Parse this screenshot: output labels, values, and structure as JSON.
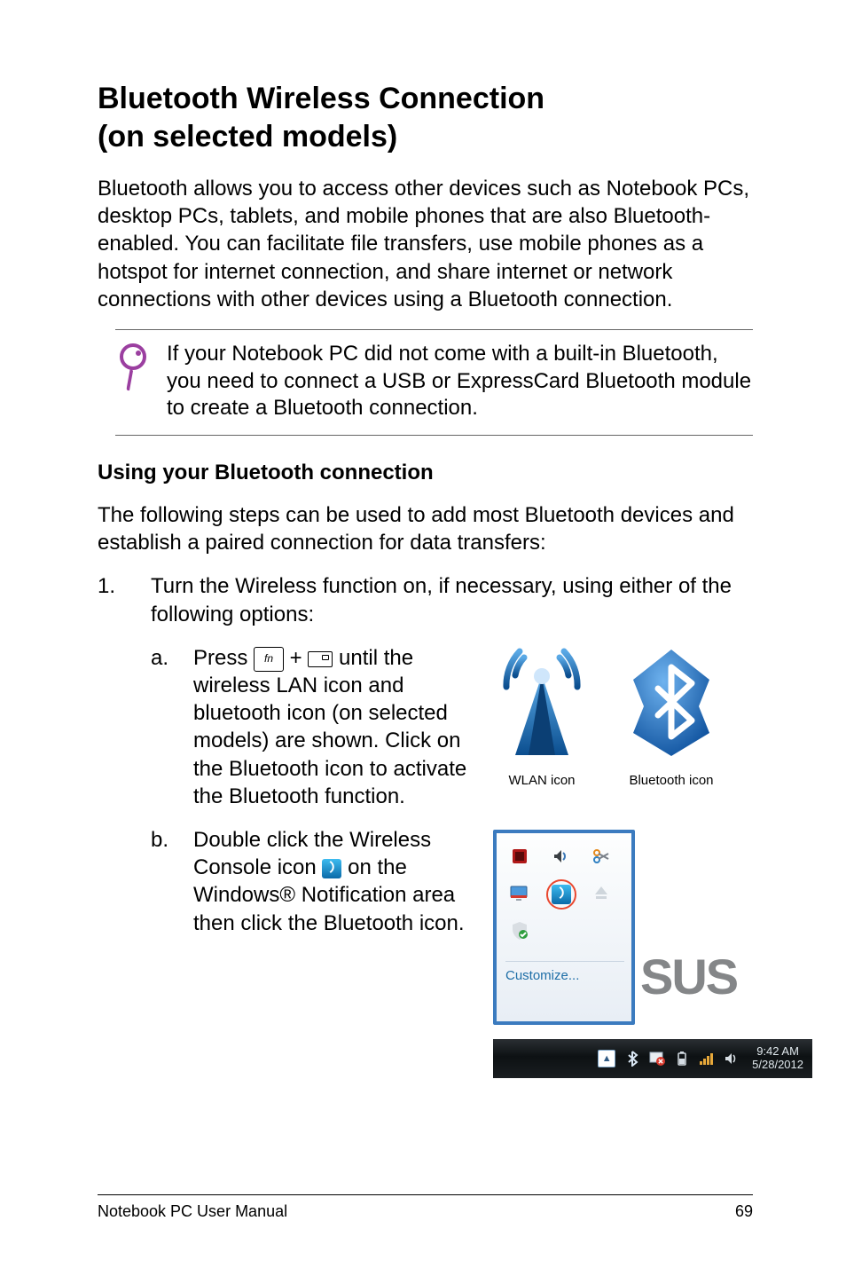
{
  "title_line1": "Bluetooth Wireless Connection",
  "title_line2": "(on selected models)",
  "intro": "Bluetooth allows you to access other devices such as Notebook PCs, desktop PCs, tablets, and mobile phones that are also Bluetooth-enabled. You can facilitate file transfers, use mobile phones as a hotspot for internet connection, and share internet or network connections with other devices using a Bluetooth connection.",
  "note": "If your Notebook PC did not come with a built-in Bluetooth, you need to connect a USB or ExpressCard Bluetooth module to create a Bluetooth connection.",
  "subheading": "Using your Bluetooth connection",
  "lead_in": "The following steps can be used to add most Bluetooth devices and establish a paired connection for data transfers:",
  "step_num": "1.",
  "step1_text": "Turn the Wireless function on, if necessary, using either of the following options:",
  "sub_a_letter": "a.",
  "sub_a_pre": "Press ",
  "sub_a_plus": " + ",
  "sub_a_post": " until the wireless LAN icon and bluetooth icon (on selected models) are shown. Click on the Bluetooth icon to activate the Bluetooth function.",
  "key_fn": "fn",
  "sub_b_letter": "b.",
  "sub_b_pre": "Double click the Wireless Console icon ",
  "sub_b_post": " on the Windows® Notification area then click the Bluetooth icon.",
  "captions": {
    "wlan": "WLAN icon",
    "bt": "Bluetooth icon"
  },
  "tray": {
    "customize": "Customize...",
    "time": "9:42 AM",
    "date": "5/28/2012",
    "brand": "SUS"
  },
  "footer": {
    "left": "Notebook PC User Manual",
    "right": "69"
  }
}
